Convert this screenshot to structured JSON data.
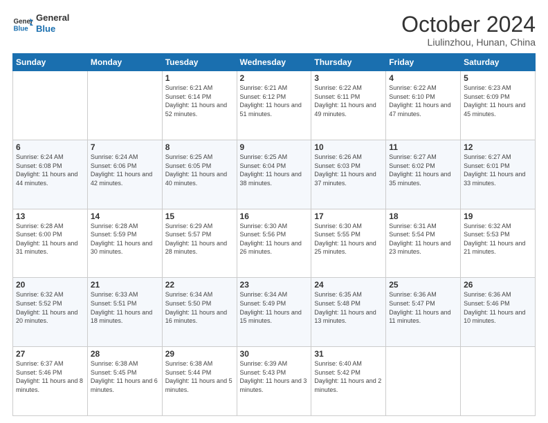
{
  "header": {
    "logo_line1": "General",
    "logo_line2": "Blue",
    "month": "October 2024",
    "location": "Liulinzhou, Hunan, China"
  },
  "weekdays": [
    "Sunday",
    "Monday",
    "Tuesday",
    "Wednesday",
    "Thursday",
    "Friday",
    "Saturday"
  ],
  "weeks": [
    [
      {
        "day": "",
        "info": ""
      },
      {
        "day": "",
        "info": ""
      },
      {
        "day": "1",
        "info": "Sunrise: 6:21 AM\nSunset: 6:14 PM\nDaylight: 11 hours and 52 minutes."
      },
      {
        "day": "2",
        "info": "Sunrise: 6:21 AM\nSunset: 6:12 PM\nDaylight: 11 hours and 51 minutes."
      },
      {
        "day": "3",
        "info": "Sunrise: 6:22 AM\nSunset: 6:11 PM\nDaylight: 11 hours and 49 minutes."
      },
      {
        "day": "4",
        "info": "Sunrise: 6:22 AM\nSunset: 6:10 PM\nDaylight: 11 hours and 47 minutes."
      },
      {
        "day": "5",
        "info": "Sunrise: 6:23 AM\nSunset: 6:09 PM\nDaylight: 11 hours and 45 minutes."
      }
    ],
    [
      {
        "day": "6",
        "info": "Sunrise: 6:24 AM\nSunset: 6:08 PM\nDaylight: 11 hours and 44 minutes."
      },
      {
        "day": "7",
        "info": "Sunrise: 6:24 AM\nSunset: 6:06 PM\nDaylight: 11 hours and 42 minutes."
      },
      {
        "day": "8",
        "info": "Sunrise: 6:25 AM\nSunset: 6:05 PM\nDaylight: 11 hours and 40 minutes."
      },
      {
        "day": "9",
        "info": "Sunrise: 6:25 AM\nSunset: 6:04 PM\nDaylight: 11 hours and 38 minutes."
      },
      {
        "day": "10",
        "info": "Sunrise: 6:26 AM\nSunset: 6:03 PM\nDaylight: 11 hours and 37 minutes."
      },
      {
        "day": "11",
        "info": "Sunrise: 6:27 AM\nSunset: 6:02 PM\nDaylight: 11 hours and 35 minutes."
      },
      {
        "day": "12",
        "info": "Sunrise: 6:27 AM\nSunset: 6:01 PM\nDaylight: 11 hours and 33 minutes."
      }
    ],
    [
      {
        "day": "13",
        "info": "Sunrise: 6:28 AM\nSunset: 6:00 PM\nDaylight: 11 hours and 31 minutes."
      },
      {
        "day": "14",
        "info": "Sunrise: 6:28 AM\nSunset: 5:59 PM\nDaylight: 11 hours and 30 minutes."
      },
      {
        "day": "15",
        "info": "Sunrise: 6:29 AM\nSunset: 5:57 PM\nDaylight: 11 hours and 28 minutes."
      },
      {
        "day": "16",
        "info": "Sunrise: 6:30 AM\nSunset: 5:56 PM\nDaylight: 11 hours and 26 minutes."
      },
      {
        "day": "17",
        "info": "Sunrise: 6:30 AM\nSunset: 5:55 PM\nDaylight: 11 hours and 25 minutes."
      },
      {
        "day": "18",
        "info": "Sunrise: 6:31 AM\nSunset: 5:54 PM\nDaylight: 11 hours and 23 minutes."
      },
      {
        "day": "19",
        "info": "Sunrise: 6:32 AM\nSunset: 5:53 PM\nDaylight: 11 hours and 21 minutes."
      }
    ],
    [
      {
        "day": "20",
        "info": "Sunrise: 6:32 AM\nSunset: 5:52 PM\nDaylight: 11 hours and 20 minutes."
      },
      {
        "day": "21",
        "info": "Sunrise: 6:33 AM\nSunset: 5:51 PM\nDaylight: 11 hours and 18 minutes."
      },
      {
        "day": "22",
        "info": "Sunrise: 6:34 AM\nSunset: 5:50 PM\nDaylight: 11 hours and 16 minutes."
      },
      {
        "day": "23",
        "info": "Sunrise: 6:34 AM\nSunset: 5:49 PM\nDaylight: 11 hours and 15 minutes."
      },
      {
        "day": "24",
        "info": "Sunrise: 6:35 AM\nSunset: 5:48 PM\nDaylight: 11 hours and 13 minutes."
      },
      {
        "day": "25",
        "info": "Sunrise: 6:36 AM\nSunset: 5:47 PM\nDaylight: 11 hours and 11 minutes."
      },
      {
        "day": "26",
        "info": "Sunrise: 6:36 AM\nSunset: 5:46 PM\nDaylight: 11 hours and 10 minutes."
      }
    ],
    [
      {
        "day": "27",
        "info": "Sunrise: 6:37 AM\nSunset: 5:46 PM\nDaylight: 11 hours and 8 minutes."
      },
      {
        "day": "28",
        "info": "Sunrise: 6:38 AM\nSunset: 5:45 PM\nDaylight: 11 hours and 6 minutes."
      },
      {
        "day": "29",
        "info": "Sunrise: 6:38 AM\nSunset: 5:44 PM\nDaylight: 11 hours and 5 minutes."
      },
      {
        "day": "30",
        "info": "Sunrise: 6:39 AM\nSunset: 5:43 PM\nDaylight: 11 hours and 3 minutes."
      },
      {
        "day": "31",
        "info": "Sunrise: 6:40 AM\nSunset: 5:42 PM\nDaylight: 11 hours and 2 minutes."
      },
      {
        "day": "",
        "info": ""
      },
      {
        "day": "",
        "info": ""
      }
    ]
  ]
}
